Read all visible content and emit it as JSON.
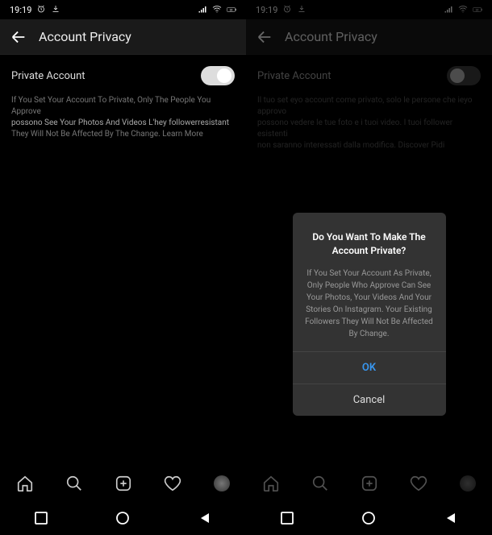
{
  "statusbar": {
    "time": "19:19",
    "battery": "32"
  },
  "header": {
    "title": "Account Privacy"
  },
  "left": {
    "toggleLabel": "Private Account",
    "desc1": "If You Set Your Account To Private, Only The People You Approve",
    "desc2": "possono See Your Photos And Videos L'hey followerresistant",
    "desc3": "They Will Not Be Affected By The Change. Learn More"
  },
  "right": {
    "toggleLabel": "Private Account",
    "desc1": "Il tuo set eyo account come privato, solo le persone che ieyo approvo",
    "desc2": "possono vedere le tue foto e i tuoi video. I tuoi follower esistenti",
    "desc3": "non saranno interessati dalla modifica. Discover Pidi"
  },
  "modal": {
    "title": "Do You Want To Make The Account Private?",
    "body": "If You Set Your Account As Private, Only People Who Approve Can See Your Photos, Your Videos And Your Stories On Instagram. Your Existing Followers They Will Not Be Affected By Change.",
    "ok": "OK",
    "cancel": "Cancel"
  }
}
